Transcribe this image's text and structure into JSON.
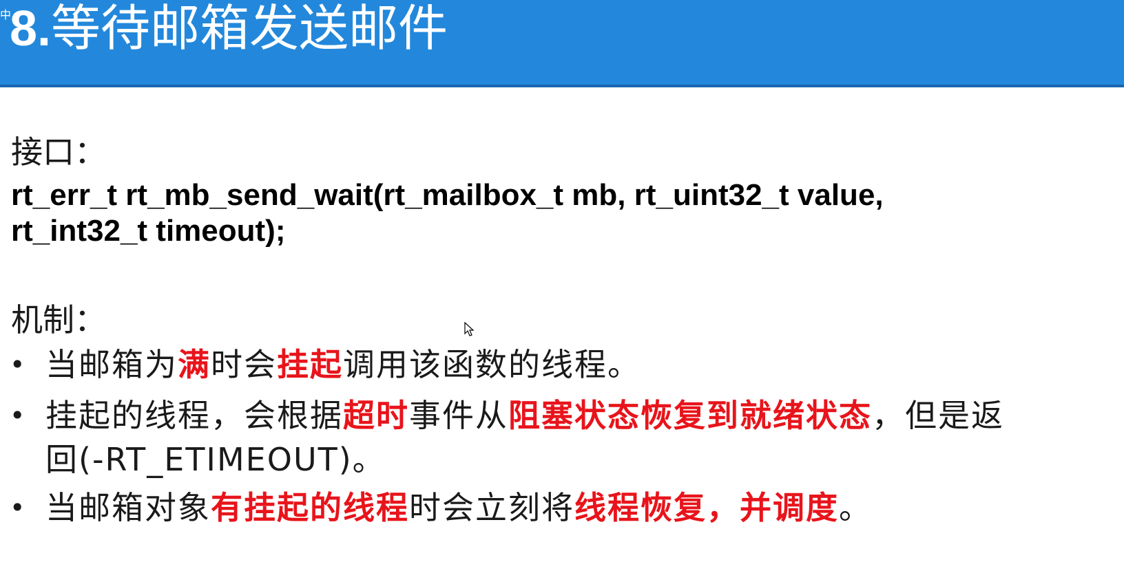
{
  "ime": {
    "indicator": "中"
  },
  "title": {
    "number": "8.",
    "text": "等待邮箱发送邮件"
  },
  "interface": {
    "label": "接口：",
    "signature_line1": "rt_err_t rt_mb_send_wait(rt_mailbox_t mb, rt_uint32_t value,",
    "signature_line2": "rt_int32_t timeout);"
  },
  "mechanism": {
    "label": "机制：",
    "bullet_symbol": "•",
    "items": [
      {
        "segments": [
          {
            "text": "当邮箱为",
            "highlight": false
          },
          {
            "text": "满",
            "highlight": true
          },
          {
            "text": "时会",
            "highlight": false
          },
          {
            "text": "挂起",
            "highlight": true
          },
          {
            "text": "调用该函数的线程。",
            "highlight": false
          }
        ]
      },
      {
        "segments": [
          {
            "text": "挂起的线程，会根据",
            "highlight": false
          },
          {
            "text": "超时",
            "highlight": true
          },
          {
            "text": "事件从",
            "highlight": false
          },
          {
            "text": "阻塞状态恢复到就绪状态",
            "highlight": true
          },
          {
            "text": "，但是返",
            "highlight": false
          },
          {
            "text": "\n",
            "highlight": false
          },
          {
            "text": "回(-RT_ETIMEOUT)。",
            "highlight": false
          }
        ]
      },
      {
        "segments": [
          {
            "text": "当邮箱对象",
            "highlight": false
          },
          {
            "text": "有挂起的线程",
            "highlight": true
          },
          {
            "text": "时会立刻将",
            "highlight": false
          },
          {
            "text": "线程恢复，并调度",
            "highlight": true
          },
          {
            "text": "。",
            "highlight": false
          }
        ]
      }
    ]
  },
  "colors": {
    "title_bar": "#2388db",
    "highlight": "#e8141b",
    "text": "#1a1a1a"
  },
  "icons": {
    "cursor": "mouse-pointer-icon"
  }
}
